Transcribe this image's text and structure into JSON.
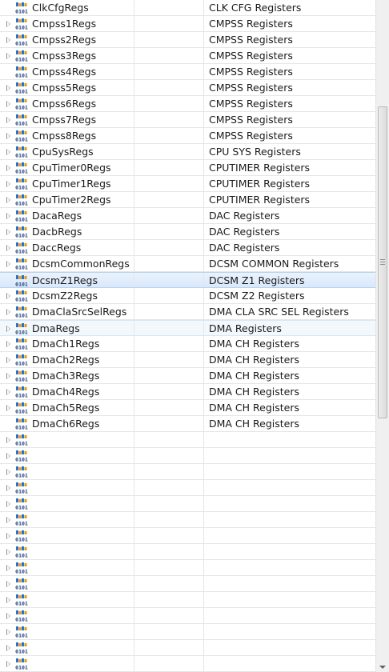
{
  "rows": [
    {
      "name": "ClkCfgRegs",
      "desc": "CLK CFG Registers",
      "expandable": false
    },
    {
      "name": "Cmpss1Regs",
      "desc": "CMPSS Registers",
      "expandable": true
    },
    {
      "name": "Cmpss2Regs",
      "desc": "CMPSS Registers",
      "expandable": true
    },
    {
      "name": "Cmpss3Regs",
      "desc": "CMPSS Registers",
      "expandable": true
    },
    {
      "name": "Cmpss4Regs",
      "desc": "CMPSS Registers",
      "expandable": false
    },
    {
      "name": "Cmpss5Regs",
      "desc": "CMPSS Registers",
      "expandable": true
    },
    {
      "name": "Cmpss6Regs",
      "desc": "CMPSS Registers",
      "expandable": true
    },
    {
      "name": "Cmpss7Regs",
      "desc": "CMPSS Registers",
      "expandable": true
    },
    {
      "name": "Cmpss8Regs",
      "desc": "CMPSS Registers",
      "expandable": true
    },
    {
      "name": "CpuSysRegs",
      "desc": "CPU SYS Registers",
      "expandable": true
    },
    {
      "name": "CpuTimer0Regs",
      "desc": "CPUTIMER Registers",
      "expandable": true
    },
    {
      "name": "CpuTimer1Regs",
      "desc": "CPUTIMER Registers",
      "expandable": true
    },
    {
      "name": "CpuTimer2Regs",
      "desc": "CPUTIMER Registers",
      "expandable": true
    },
    {
      "name": "DacaRegs",
      "desc": "DAC Registers",
      "expandable": true
    },
    {
      "name": "DacbRegs",
      "desc": "DAC Registers",
      "expandable": true
    },
    {
      "name": "DaccRegs",
      "desc": "DAC Registers",
      "expandable": true
    },
    {
      "name": "DcsmCommonRegs",
      "desc": "DCSM COMMON Registers",
      "expandable": true
    },
    {
      "name": "DcsmZ1Regs",
      "desc": "DCSM Z1 Registers",
      "expandable": false,
      "state": "selected"
    },
    {
      "name": "DcsmZ2Regs",
      "desc": "DCSM Z2 Registers",
      "expandable": true
    },
    {
      "name": "DmaClaSrcSelRegs",
      "desc": "DMA CLA SRC SEL Registers",
      "expandable": true
    },
    {
      "name": "DmaRegs",
      "desc": "DMA Registers",
      "expandable": true,
      "state": "hover"
    },
    {
      "name": "DmaCh1Regs",
      "desc": "DMA CH Registers",
      "expandable": true
    },
    {
      "name": "DmaCh2Regs",
      "desc": "DMA CH Registers",
      "expandable": true
    },
    {
      "name": "DmaCh3Regs",
      "desc": "DMA CH Registers",
      "expandable": true
    },
    {
      "name": "DmaCh4Regs",
      "desc": "DMA CH Registers",
      "expandable": true
    },
    {
      "name": "DmaCh5Regs",
      "desc": "DMA CH Registers",
      "expandable": true
    },
    {
      "name": "DmaCh6Regs",
      "desc": "DMA CH Registers",
      "expandable": false
    },
    {
      "name": "",
      "desc": "",
      "expandable": true
    },
    {
      "name": "",
      "desc": "",
      "expandable": true
    },
    {
      "name": "",
      "desc": "",
      "expandable": true
    },
    {
      "name": "",
      "desc": "",
      "expandable": true
    },
    {
      "name": "",
      "desc": "",
      "expandable": true
    },
    {
      "name": "",
      "desc": "",
      "expandable": true
    },
    {
      "name": "",
      "desc": "",
      "expandable": true
    },
    {
      "name": "",
      "desc": "",
      "expandable": true
    },
    {
      "name": "",
      "desc": "",
      "expandable": true
    },
    {
      "name": "",
      "desc": "",
      "expandable": true
    },
    {
      "name": "",
      "desc": "",
      "expandable": true
    },
    {
      "name": "",
      "desc": "",
      "expandable": true
    },
    {
      "name": "",
      "desc": "",
      "expandable": true
    },
    {
      "name": "",
      "desc": "",
      "expandable": true
    },
    {
      "name": "",
      "desc": "",
      "expandable": true
    }
  ],
  "icon": "register-group-icon",
  "icon_digits": "0101",
  "colors": {
    "selected_bg": "#d9e8fa",
    "hover_bg": "#f3f8fd",
    "grid": "#e6e6e6",
    "icon_blue": "#2a6fc9",
    "icon_orange": "#e39a1c"
  }
}
